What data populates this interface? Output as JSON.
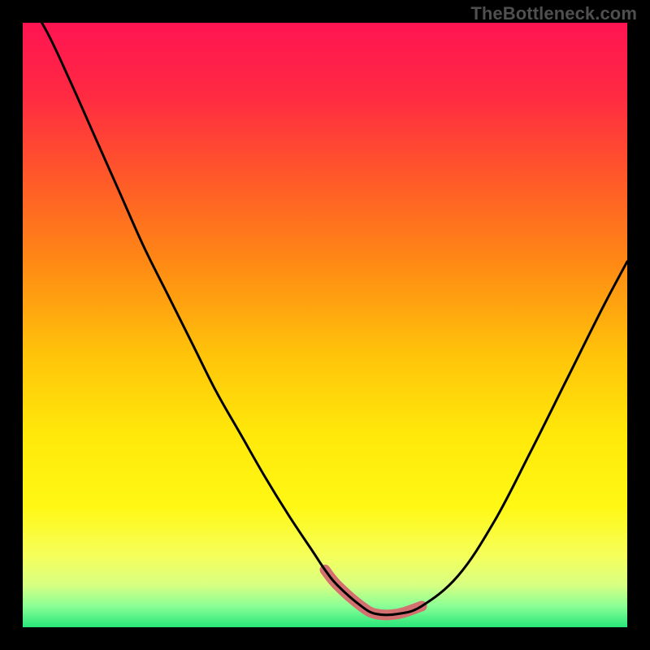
{
  "attribution": "TheBottleneck.com",
  "gradient_stops": [
    {
      "offset": 0.0,
      "color": "#ff1452"
    },
    {
      "offset": 0.12,
      "color": "#ff2a42"
    },
    {
      "offset": 0.26,
      "color": "#ff5a28"
    },
    {
      "offset": 0.4,
      "color": "#ff8a14"
    },
    {
      "offset": 0.55,
      "color": "#ffc40a"
    },
    {
      "offset": 0.68,
      "color": "#ffe80a"
    },
    {
      "offset": 0.8,
      "color": "#fff814"
    },
    {
      "offset": 0.88,
      "color": "#f6ff5a"
    },
    {
      "offset": 0.93,
      "color": "#d8ff82"
    },
    {
      "offset": 0.965,
      "color": "#8aff96"
    },
    {
      "offset": 1.0,
      "color": "#28e67a"
    }
  ],
  "curve_color": "#000000",
  "highlight_color": "#d47070",
  "chart_data": {
    "type": "line",
    "title": "",
    "xlabel": "",
    "ylabel": "",
    "xlim": [
      0,
      1
    ],
    "ylim": [
      0,
      1
    ],
    "series": [
      {
        "name": "bottleneck-curve",
        "x": [
          0.0,
          0.04,
          0.08,
          0.12,
          0.16,
          0.2,
          0.24,
          0.28,
          0.32,
          0.36,
          0.4,
          0.44,
          0.48,
          0.5,
          0.52,
          0.56,
          0.585,
          0.62,
          0.66,
          0.72,
          0.78,
          0.84,
          0.9,
          0.96,
          1.0
        ],
        "y": [
          1.05,
          0.985,
          0.9,
          0.81,
          0.72,
          0.63,
          0.55,
          0.47,
          0.39,
          0.32,
          0.25,
          0.185,
          0.125,
          0.095,
          0.07,
          0.035,
          0.022,
          0.022,
          0.035,
          0.085,
          0.175,
          0.29,
          0.41,
          0.53,
          0.605
        ]
      }
    ],
    "highlight_range_x": [
      0.5,
      0.66
    ],
    "annotations": []
  }
}
